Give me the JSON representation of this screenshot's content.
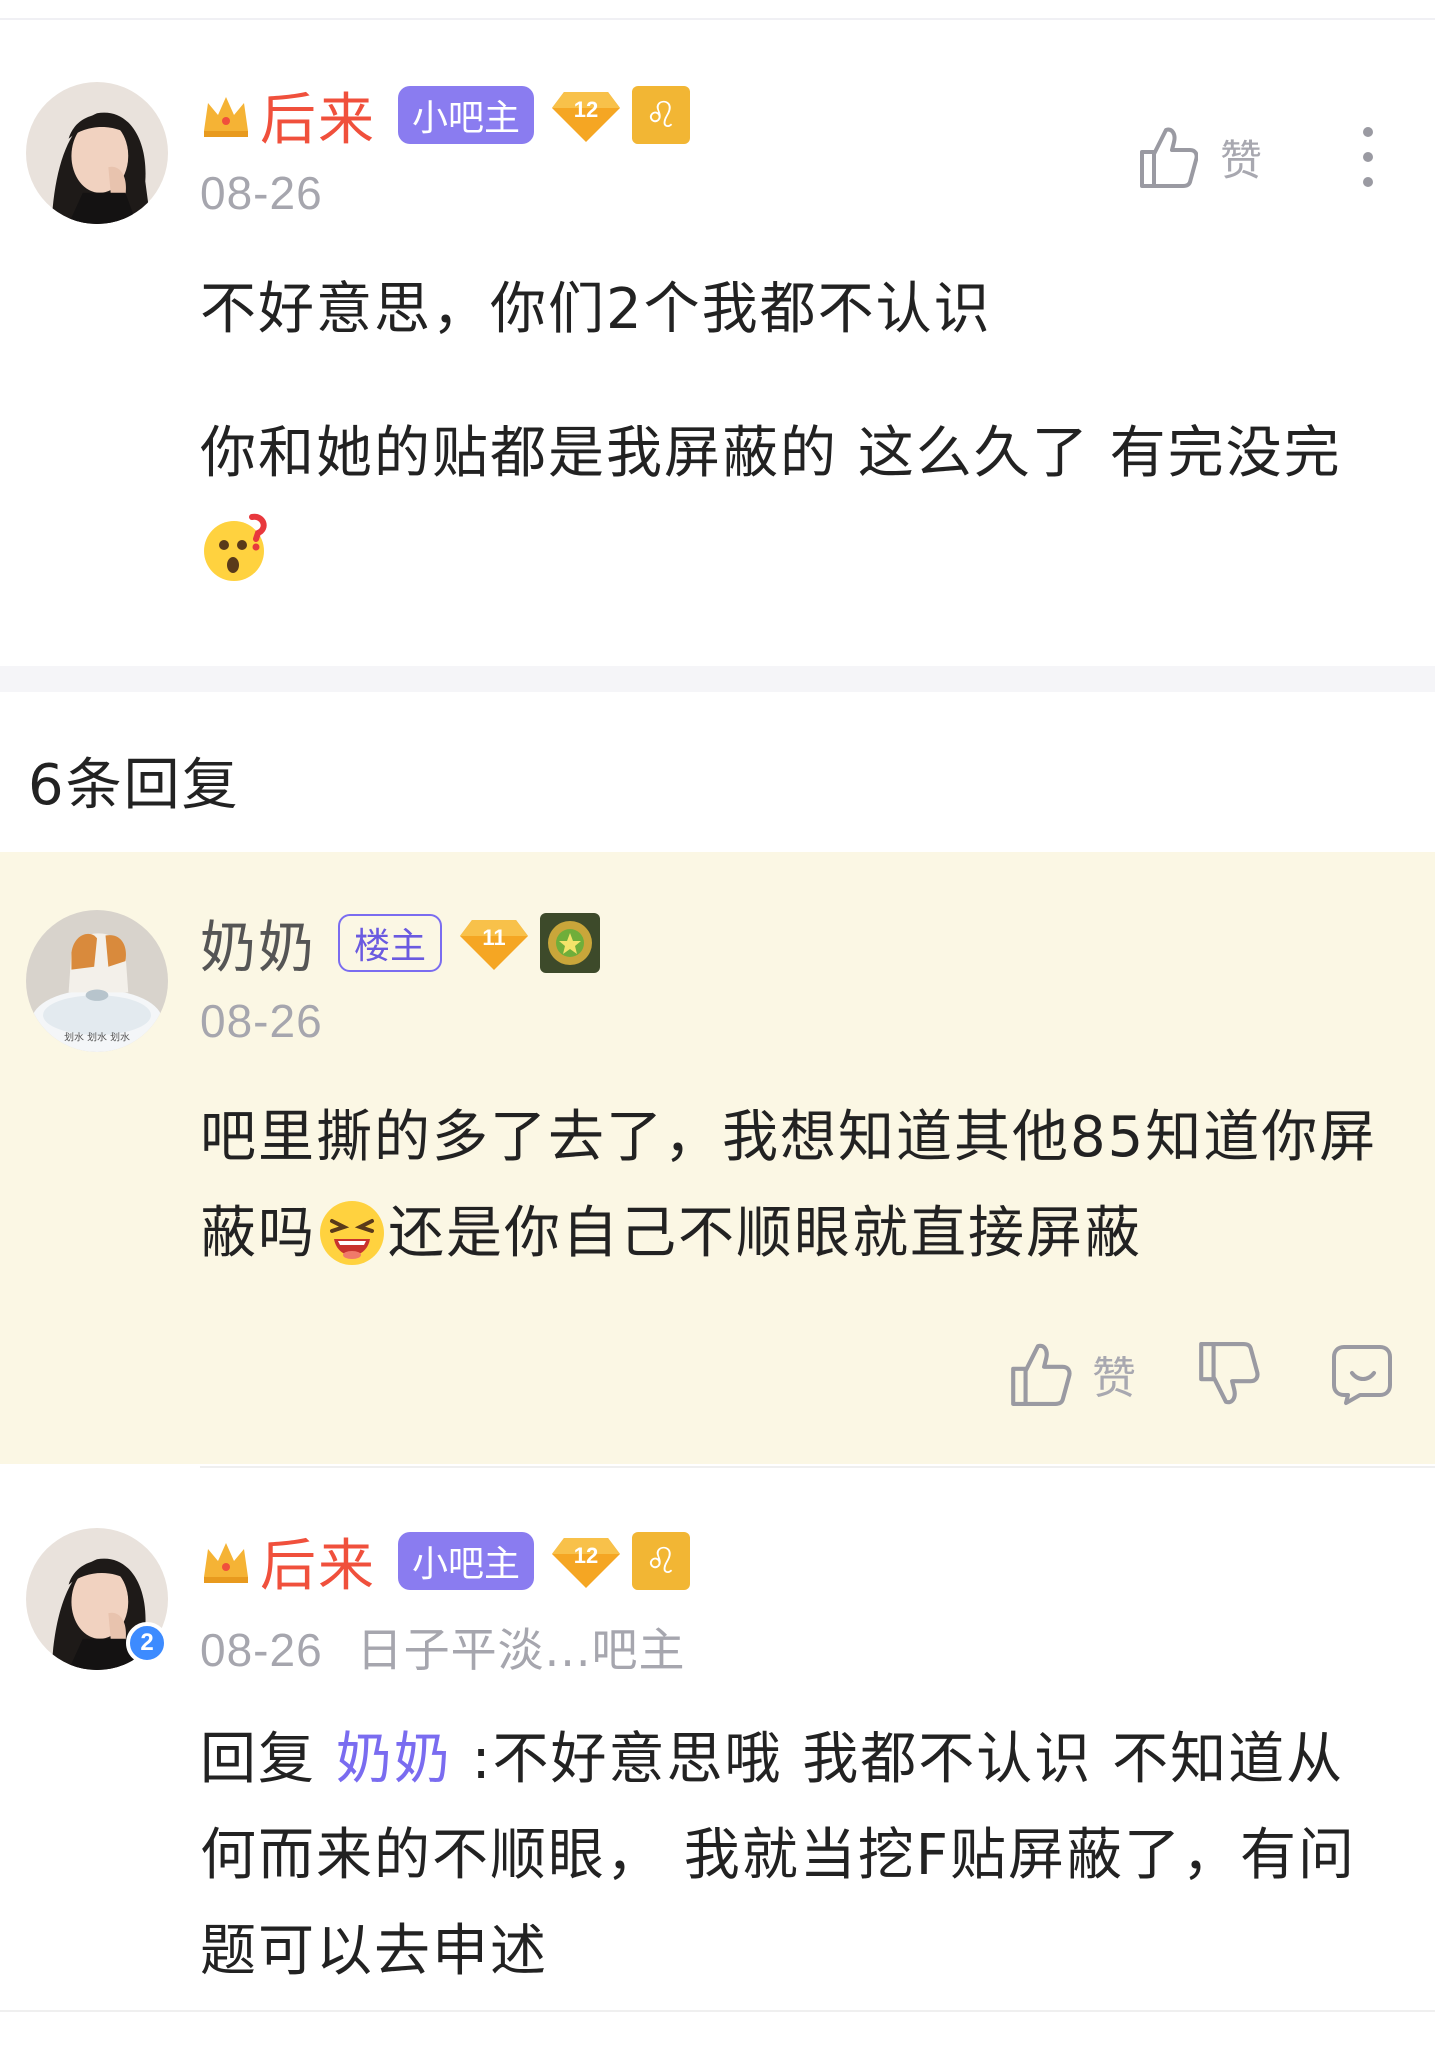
{
  "post": {
    "username": "后来",
    "role_tag": "小吧主",
    "level": "12",
    "zodiac_symbol": "♌",
    "date": "08-26",
    "like_label": "赞",
    "paragraphs": [
      "不好意思，你们2个我都不认识",
      "你和她的贴都是我屏蔽的 这么久了 有完没完"
    ],
    "emoji_after_paragraph2": "question-face-emoji"
  },
  "replies_header": "6条回复",
  "replies": [
    {
      "username": "奶奶",
      "role_tag": "楼主",
      "level": "11",
      "date": "08-26",
      "avatar_caption": "划水 划水 划水",
      "text_part1": "吧里撕的多了去了，我想知道其他85知道你屏蔽吗",
      "text_part2": "还是你自己不顺眼就直接屏蔽",
      "like_label": "赞"
    },
    {
      "username": "后来",
      "role_tag": "小吧主",
      "level": "12",
      "zodiac_symbol": "♌",
      "date": "08-26",
      "extra_meta": "日子平淡...吧主",
      "avatar_badge": "2",
      "reply_prefix": "回复 ",
      "reply_to": "奶奶",
      "text": " :不好意思哦 我都不认识 不知道从何而来的不顺眼， 我就当挖F贴屏蔽了，有问题可以去申述"
    }
  ],
  "colors": {
    "admin_name": "#f0503c",
    "tag_purple": "#8a7cf0",
    "highlight_bg": "#fbf7e4",
    "meta_gray": "#a6a6ae",
    "gem_gold": "#f5a623"
  }
}
